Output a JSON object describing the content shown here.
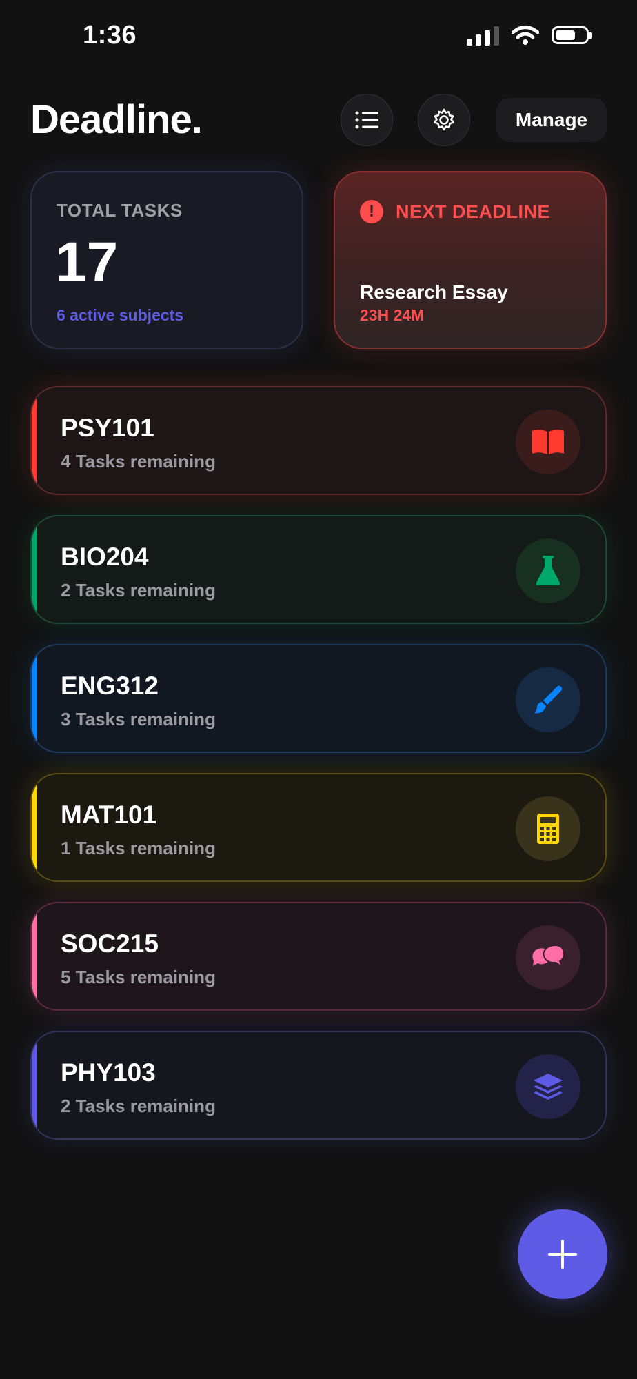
{
  "status_bar": {
    "time": "1:36"
  },
  "header": {
    "title": "Deadline.",
    "list_button": "list-icon",
    "settings_button": "gear-icon",
    "manage_label": "Manage"
  },
  "summary": {
    "total": {
      "label": "TOTAL TASKS",
      "value": "17",
      "subtitle": "6 active subjects"
    },
    "next": {
      "label": "NEXT DEADLINE",
      "title": "Research Essay",
      "countdown": "23H 24M"
    }
  },
  "subjects": [
    {
      "code": "PSY101",
      "remaining": "4 Tasks remaining",
      "color": "#ff3b30",
      "icon": "book-icon"
    },
    {
      "code": "BIO204",
      "remaining": "2 Tasks remaining",
      "color": "#00a86b",
      "icon": "flask-icon"
    },
    {
      "code": "ENG312",
      "remaining": "3 Tasks remaining",
      "color": "#0a84ff",
      "icon": "brush-icon"
    },
    {
      "code": "MAT101",
      "remaining": "1 Tasks remaining",
      "color": "#ffd60a",
      "icon": "calculator-icon"
    },
    {
      "code": "SOC215",
      "remaining": "5 Tasks remaining",
      "color": "#ff6fa6",
      "icon": "chat-bubbles-icon"
    },
    {
      "code": "PHY103",
      "remaining": "2 Tasks remaining",
      "color": "#5e5ce6",
      "icon": "layers-icon"
    }
  ],
  "fab": {
    "icon": "plus-icon",
    "color": "#5e5ce6"
  }
}
